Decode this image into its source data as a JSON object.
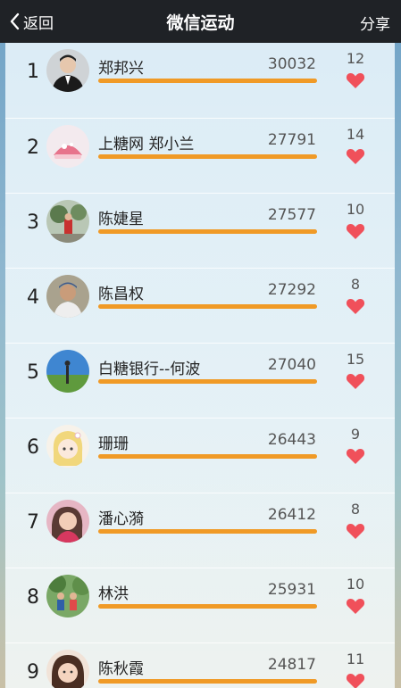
{
  "nav": {
    "back_label": "返回",
    "title": "微信运动",
    "share_label": "分享"
  },
  "rankings": [
    {
      "rank": "1",
      "name": "郑邦兴",
      "steps": "30032",
      "likes": "12",
      "progress": 1.0
    },
    {
      "rank": "2",
      "name": "上糖网 郑小兰",
      "steps": "27791",
      "likes": "14",
      "progress": 1.0
    },
    {
      "rank": "3",
      "name": "陈婕星",
      "steps": "27577",
      "likes": "10",
      "progress": 1.0
    },
    {
      "rank": "4",
      "name": "陈昌权",
      "steps": "27292",
      "likes": "8",
      "progress": 1.0
    },
    {
      "rank": "5",
      "name": "白糖银行--何波",
      "steps": "27040",
      "likes": "15",
      "progress": 1.0
    },
    {
      "rank": "6",
      "name": "珊珊",
      "steps": "26443",
      "likes": "9",
      "progress": 1.0
    },
    {
      "rank": "7",
      "name": "潘心漪",
      "steps": "26412",
      "likes": "8",
      "progress": 1.0
    },
    {
      "rank": "8",
      "name": "林洪",
      "steps": "25931",
      "likes": "10",
      "progress": 1.0
    },
    {
      "rank": "9",
      "name": "陈秋霞",
      "steps": "24817",
      "likes": "11",
      "progress": 1.0
    }
  ],
  "colors": {
    "bar": "#f09a26",
    "heart": "#f0505a",
    "topbar": "#1f2226"
  },
  "icons": {
    "back": "chevron-left-icon",
    "like": "heart-icon",
    "avatar": "avatar-photo"
  }
}
